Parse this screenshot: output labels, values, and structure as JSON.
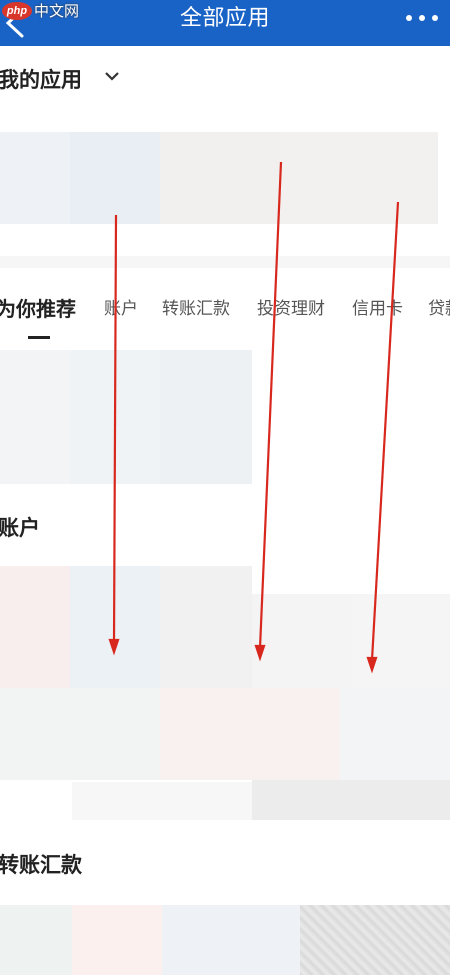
{
  "header": {
    "title": "全部应用",
    "back_icon": "back-arrow-icon",
    "more_icon": "more-dots-icon"
  },
  "watermark": {
    "logo_text": "php",
    "site_text": "中文网"
  },
  "my_apps": {
    "title": "我的应用",
    "toggle_icon": "chevron-down-icon"
  },
  "recommend": {
    "tabs": [
      "为你推荐",
      "账户",
      "转账汇款",
      "投资理财",
      "信用卡",
      "贷款"
    ]
  },
  "sections": {
    "account_title": "账户",
    "transfer_title": "转账汇款"
  },
  "annotations": {
    "arrow_color": "#d8281e",
    "arrow_count": 3
  },
  "colors": {
    "header_bg": "#1a63c6",
    "text_primary": "#222222"
  }
}
